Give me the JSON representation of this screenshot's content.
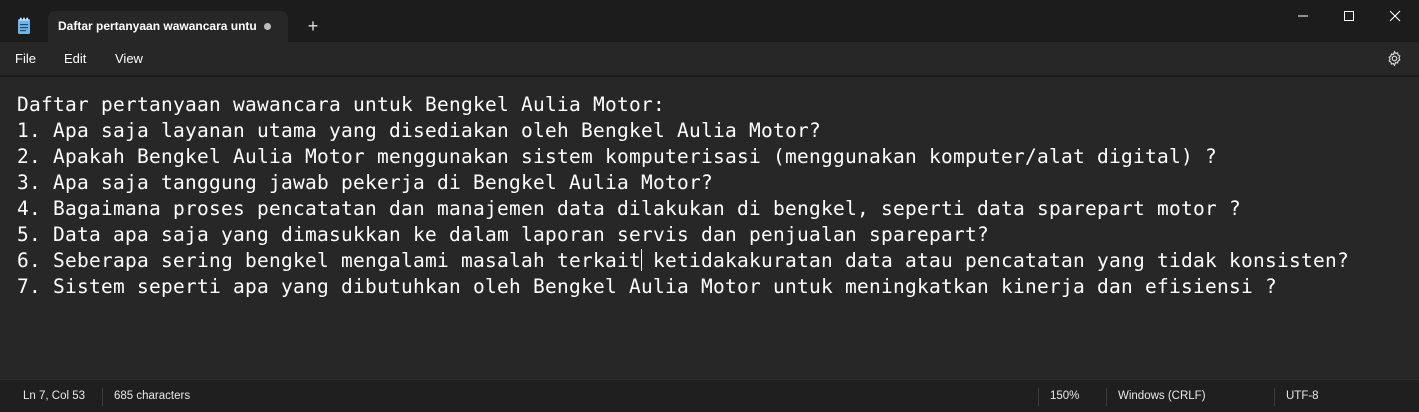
{
  "window": {
    "tab_title": "Daftar pertanyaan wawancara untu",
    "new_tab_symbol": "+"
  },
  "menu": {
    "file": "File",
    "edit": "Edit",
    "view": "View"
  },
  "editor": {
    "lines": [
      "Daftar pertanyaan wawancara untuk Bengkel Aulia Motor:",
      "1. Apa saja layanan utama yang disediakan oleh Bengkel Aulia Motor?",
      "2. Apakah Bengkel Aulia Motor menggunakan sistem komputerisasi (menggunakan komputer/alat digital) ?",
      "3. Apa saja tanggung jawab pekerja di Bengkel Aulia Motor?",
      "4. Bagaimana proses pencatatan dan manajemen data dilakukan di bengkel, seperti data sparepart motor ?",
      "5. Data apa saja yang dimasukkan ke dalam laporan servis dan penjualan sparepart?",
      "6. Seberapa sering bengkel mengalami masalah terkait ketidakakuratan data atau pencatatan yang tidak konsisten?",
      "7. Sistem seperti apa yang dibutuhkan oleh Bengkel Aulia Motor untuk meningkatkan kinerja dan efisiensi ?"
    ]
  },
  "status": {
    "position": "Ln 7, Col 53",
    "characters": "685 characters",
    "zoom": "150%",
    "line_ending": "Windows (CRLF)",
    "encoding": "UTF-8"
  },
  "icons": {
    "app": "notepad-icon",
    "settings": "gear-icon",
    "minimize": "minimize-icon",
    "maximize": "maximize-icon",
    "close": "close-icon",
    "unsaved": "unsaved-dot-icon"
  },
  "colors": {
    "background": "#272727",
    "titlebar": "#1c1c1c",
    "text": "#ffffff",
    "app_icon_accent": "#6fb6e8"
  }
}
